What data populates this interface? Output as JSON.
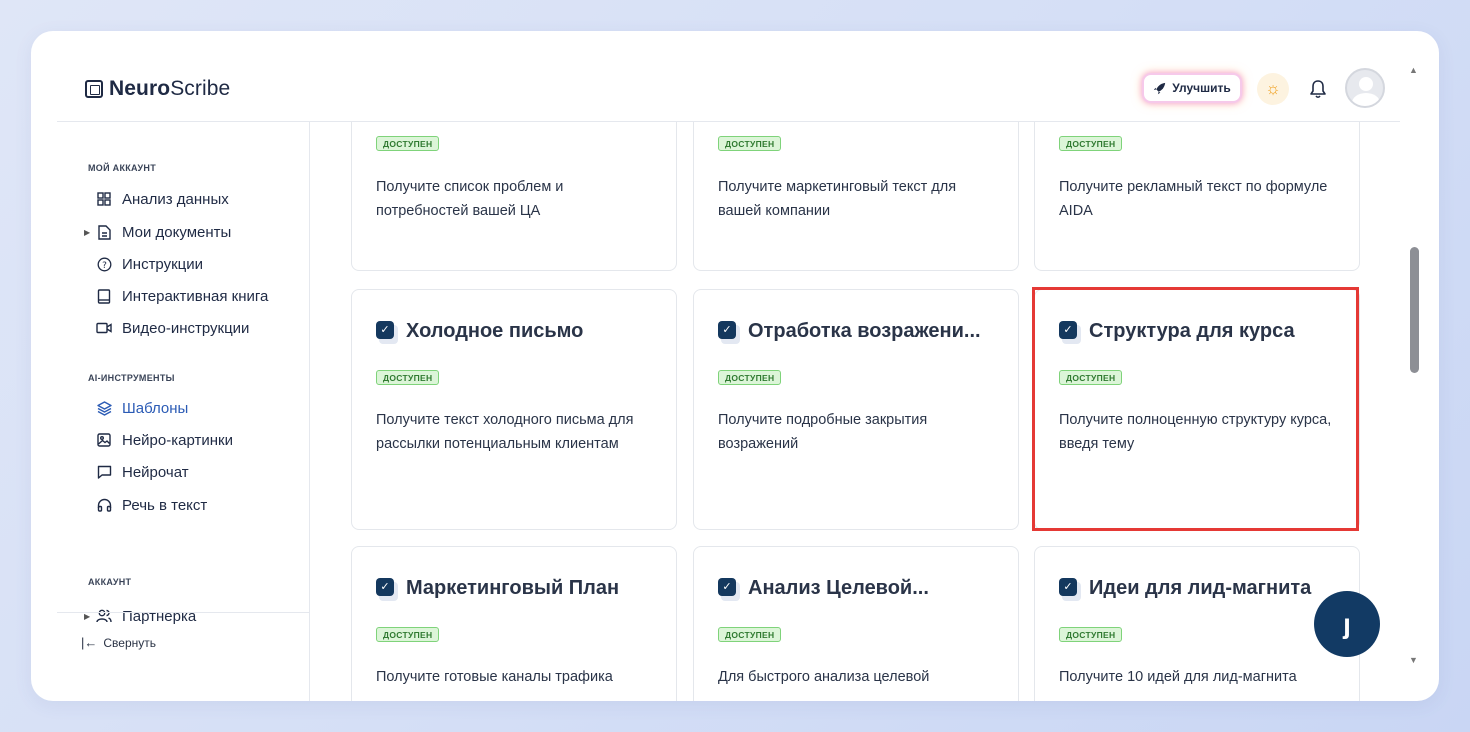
{
  "header": {
    "brand_bold": "Neuro",
    "brand_rest": "Scribe",
    "upgrade_label": "Улучшить"
  },
  "sidebar": {
    "section_account": "МОЙ АККАУНТ",
    "items_account": [
      {
        "label": "Анализ данных",
        "icon": "grid-icon"
      },
      {
        "label": "Мои документы",
        "icon": "document-icon"
      },
      {
        "label": "Инструкции",
        "icon": "help-circle-icon"
      },
      {
        "label": "Интерактивная книга",
        "icon": "book-icon"
      },
      {
        "label": "Видео-инструкции",
        "icon": "video-icon"
      }
    ],
    "section_ai": "AI-ИНСТРУМЕНТЫ",
    "items_ai": [
      {
        "label": "Шаблоны",
        "icon": "layers-icon"
      },
      {
        "label": "Нейро-картинки",
        "icon": "image-icon"
      },
      {
        "label": "Нейрочат",
        "icon": "chat-icon"
      },
      {
        "label": "Речь в текст",
        "icon": "headphones-icon"
      }
    ],
    "section_acc2": "АККАУНТ",
    "items_acc2": [
      {
        "label": "Партнерка",
        "icon": "users-icon"
      }
    ],
    "collapse_label": "Свернуть"
  },
  "cards": {
    "row1": [
      {
        "badge": "ДОСТУПЕН",
        "desc": "Получите список проблем и потребностей вашей ЦА"
      },
      {
        "badge": "ДОСТУПЕН",
        "desc": "Получите маркетинговый текст для вашей компании"
      },
      {
        "badge": "ДОСТУПЕН",
        "desc": "Получите рекламный текст по формуле AIDA"
      }
    ],
    "row2": [
      {
        "title": "Холодное письмо",
        "badge": "ДОСТУПЕН",
        "desc": "Получите текст холодного письма для рассылки потенциальным клиентам"
      },
      {
        "title": "Отработка возражени...",
        "badge": "ДОСТУПЕН",
        "desc": "Получите подробные закрытия возражений"
      },
      {
        "title": "Структура для курса",
        "badge": "ДОСТУПЕН",
        "desc": "Получите полноценную структуру курса, введя тему"
      }
    ],
    "row3": [
      {
        "title": "Маркетинговый План",
        "badge": "ДОСТУПЕН",
        "desc": "Получите готовые каналы трафика"
      },
      {
        "title": "Анализ Целевой...",
        "badge": "ДОСТУПЕН",
        "desc": "Для быстрого анализа целевой"
      },
      {
        "title": "Идеи для лид-магнита",
        "badge": "ДОСТУПЕН",
        "desc": "Получите 10 идей для лид-магнита"
      }
    ]
  },
  "fab_glyph": "ȷ",
  "colors": {
    "accent_active": "#2b5bb5",
    "badge_bg": "#dcf5d8",
    "badge_text": "#2f7a30",
    "highlight": "#e53935",
    "fab": "#123a64"
  }
}
